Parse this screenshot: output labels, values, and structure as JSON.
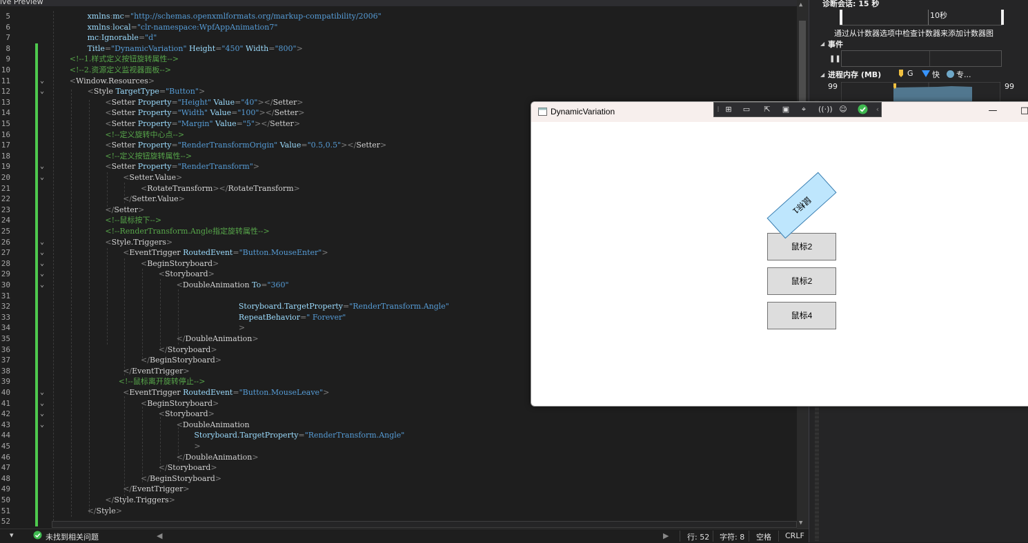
{
  "editor": {
    "tab_title": "ive Preview",
    "line_numbers": [
      "5",
      "6",
      "7",
      "8",
      "9",
      "10",
      "11",
      "12",
      "13",
      "14",
      "15",
      "16",
      "17",
      "18",
      "19",
      "20",
      "21",
      "22",
      "23",
      "24",
      "25",
      "26",
      "27",
      "28",
      "29",
      "30",
      "31",
      "32",
      "33",
      "34",
      "35",
      "36",
      "37",
      "38",
      "39",
      "40",
      "41",
      "42",
      "43",
      "44",
      "45",
      "46",
      "47",
      "48",
      "49",
      "50",
      "51",
      "52"
    ],
    "lines": [
      [
        [
          "at",
          "xmlns"
        ],
        [
          "pn",
          ":"
        ],
        [
          "at",
          "mc"
        ],
        [
          "pn",
          "="
        ],
        [
          "st",
          "\"http://schemas.openxmlformats.org/markup-compatibility/2006\""
        ]
      ],
      [
        [
          "at",
          "xmlns"
        ],
        [
          "pn",
          ":"
        ],
        [
          "at",
          "local"
        ],
        [
          "pn",
          "="
        ],
        [
          "st",
          "\"clr-namespace:WpfAppAnimation7\""
        ]
      ],
      [
        [
          "at",
          "mc"
        ],
        [
          "pn",
          ":"
        ],
        [
          "at",
          "Ignorable"
        ],
        [
          "pn",
          "="
        ],
        [
          "st",
          "\"d\""
        ]
      ],
      [
        [
          "at",
          "Title"
        ],
        [
          "pn",
          "="
        ],
        [
          "st",
          "\"DynamicVariation\""
        ],
        [
          "at",
          " Height"
        ],
        [
          "pn",
          "="
        ],
        [
          "st",
          "\"450\""
        ],
        [
          "at",
          " Width"
        ],
        [
          "pn",
          "="
        ],
        [
          "st",
          "\"800\""
        ],
        [
          "pn",
          ">"
        ]
      ],
      [
        [
          "cm",
          "<!--1.样式定义按钮旋转属性-->"
        ]
      ],
      [
        [
          "cm",
          "<!--2.资源定义监视器面板-->"
        ]
      ],
      [
        [
          "pn",
          "<"
        ],
        [
          "el",
          "Window.Resources"
        ],
        [
          "pn",
          ">"
        ]
      ],
      [
        [
          "pn",
          "<"
        ],
        [
          "el",
          "Style"
        ],
        [
          "at",
          " TargetType"
        ],
        [
          "pn",
          "="
        ],
        [
          "st",
          "\"Button\""
        ],
        [
          "pn",
          ">"
        ]
      ],
      [
        [
          "pn",
          "<"
        ],
        [
          "el",
          "Setter"
        ],
        [
          "at",
          " Property"
        ],
        [
          "pn",
          "="
        ],
        [
          "st",
          "\"Height\""
        ],
        [
          "at",
          " Value"
        ],
        [
          "pn",
          "="
        ],
        [
          "st",
          "\"40\""
        ],
        [
          "pn",
          "></"
        ],
        [
          "el",
          "Setter"
        ],
        [
          "pn",
          ">"
        ]
      ],
      [
        [
          "pn",
          "<"
        ],
        [
          "el",
          "Setter"
        ],
        [
          "at",
          " Property"
        ],
        [
          "pn",
          "="
        ],
        [
          "st",
          "\"Width\""
        ],
        [
          "at",
          " Value"
        ],
        [
          "pn",
          "="
        ],
        [
          "st",
          "\"100\""
        ],
        [
          "pn",
          "></"
        ],
        [
          "el",
          "Setter"
        ],
        [
          "pn",
          ">"
        ]
      ],
      [
        [
          "pn",
          "<"
        ],
        [
          "el",
          "Setter"
        ],
        [
          "at",
          " Property"
        ],
        [
          "pn",
          "="
        ],
        [
          "st",
          "\"Margin\""
        ],
        [
          "at",
          " Value"
        ],
        [
          "pn",
          "="
        ],
        [
          "st",
          "\"5\""
        ],
        [
          "pn",
          "></"
        ],
        [
          "el",
          "Setter"
        ],
        [
          "pn",
          ">"
        ]
      ],
      [
        [
          "cm",
          "<!--定义旋转中心点-->"
        ]
      ],
      [
        [
          "pn",
          "<"
        ],
        [
          "el",
          "Setter"
        ],
        [
          "at",
          " Property"
        ],
        [
          "pn",
          "="
        ],
        [
          "st",
          "\"RenderTransformOrigin\""
        ],
        [
          "at",
          " Value"
        ],
        [
          "pn",
          "="
        ],
        [
          "st",
          "\"0.5,0.5\""
        ],
        [
          "pn",
          "></"
        ],
        [
          "el",
          "Setter"
        ],
        [
          "pn",
          ">"
        ]
      ],
      [
        [
          "cm",
          "<!--定义按钮旋转属性-->"
        ]
      ],
      [
        [
          "pn",
          "<"
        ],
        [
          "el",
          "Setter"
        ],
        [
          "at",
          " Property"
        ],
        [
          "pn",
          "="
        ],
        [
          "st",
          "\"RenderTransform\""
        ],
        [
          "pn",
          ">"
        ]
      ],
      [
        [
          "pn",
          "<"
        ],
        [
          "el",
          "Setter.Value"
        ],
        [
          "pn",
          ">"
        ]
      ],
      [
        [
          "pn",
          "<"
        ],
        [
          "el",
          "RotateTransform"
        ],
        [
          "pn",
          "></"
        ],
        [
          "el",
          "RotateTransform"
        ],
        [
          "pn",
          ">"
        ]
      ],
      [
        [
          "pn",
          "</"
        ],
        [
          "el",
          "Setter.Value"
        ],
        [
          "pn",
          ">"
        ]
      ],
      [
        [
          "pn",
          "</"
        ],
        [
          "el",
          "Setter"
        ],
        [
          "pn",
          ">"
        ]
      ],
      [
        [
          "cm",
          "<!--鼠标按下-->"
        ]
      ],
      [
        [
          "cm",
          "<!--RenderTransform.Angle指定旋转属性-->"
        ]
      ],
      [
        [
          "pn",
          "<"
        ],
        [
          "el",
          "Style.Triggers"
        ],
        [
          "pn",
          ">"
        ]
      ],
      [
        [
          "pn",
          "<"
        ],
        [
          "el",
          "EventTrigger"
        ],
        [
          "at",
          " RoutedEvent"
        ],
        [
          "pn",
          "="
        ],
        [
          "st",
          "\"Button.MouseEnter\""
        ],
        [
          "pn",
          ">"
        ]
      ],
      [
        [
          "pn",
          "<"
        ],
        [
          "el",
          "BeginStoryboard"
        ],
        [
          "pn",
          ">"
        ]
      ],
      [
        [
          "pn",
          "<"
        ],
        [
          "el",
          "Storyboard"
        ],
        [
          "pn",
          ">"
        ]
      ],
      [
        [
          "pn",
          "<"
        ],
        [
          "el",
          "DoubleAnimation"
        ],
        [
          "at",
          " To"
        ],
        [
          "pn",
          "="
        ],
        [
          "st",
          "\"360\""
        ]
      ],
      [],
      [
        [
          "at",
          "Storyboard.TargetProperty"
        ],
        [
          "pn",
          "="
        ],
        [
          "st",
          "\"RenderTransform.Angle\""
        ]
      ],
      [
        [
          "at",
          "RepeatBehavior"
        ],
        [
          "pn",
          "="
        ],
        [
          "st",
          "\" Forever\""
        ]
      ],
      [
        [
          "pn",
          ">"
        ]
      ],
      [
        [
          "pn",
          "</"
        ],
        [
          "el",
          "DoubleAnimation"
        ],
        [
          "pn",
          ">"
        ]
      ],
      [
        [
          "pn",
          "</"
        ],
        [
          "el",
          "Storyboard"
        ],
        [
          "pn",
          ">"
        ]
      ],
      [
        [
          "pn",
          "</"
        ],
        [
          "el",
          "BeginStoryboard"
        ],
        [
          "pn",
          ">"
        ]
      ],
      [
        [
          "pn",
          "</"
        ],
        [
          "el",
          "EventTrigger"
        ],
        [
          "pn",
          ">"
        ]
      ],
      [
        [
          "cm",
          "<!--鼠标离开旋转停止-->"
        ]
      ],
      [
        [
          "pn",
          "<"
        ],
        [
          "el",
          "EventTrigger"
        ],
        [
          "at",
          " RoutedEvent"
        ],
        [
          "pn",
          "="
        ],
        [
          "st",
          "\"Button.MouseLeave\""
        ],
        [
          "pn",
          ">"
        ]
      ],
      [
        [
          "pn",
          "<"
        ],
        [
          "el",
          "BeginStoryboard"
        ],
        [
          "pn",
          ">"
        ]
      ],
      [
        [
          "pn",
          "<"
        ],
        [
          "el",
          "Storyboard"
        ],
        [
          "pn",
          ">"
        ]
      ],
      [
        [
          "pn",
          "<"
        ],
        [
          "el",
          "DoubleAnimation"
        ]
      ],
      [
        [
          "at",
          "Storyboard.TargetProperty"
        ],
        [
          "pn",
          "="
        ],
        [
          "st",
          "\"RenderTransform.Angle\""
        ]
      ],
      [
        [
          "pn",
          ">"
        ]
      ],
      [
        [
          "pn",
          "</"
        ],
        [
          "el",
          "DoubleAnimation"
        ],
        [
          "pn",
          ">"
        ]
      ],
      [
        [
          "pn",
          "</"
        ],
        [
          "el",
          "Storyboard"
        ],
        [
          "pn",
          ">"
        ]
      ],
      [
        [
          "pn",
          "</"
        ],
        [
          "el",
          "BeginStoryboard"
        ],
        [
          "pn",
          ">"
        ]
      ],
      [
        [
          "pn",
          "</"
        ],
        [
          "el",
          "EventTrigger"
        ],
        [
          "pn",
          ">"
        ]
      ],
      [
        [
          "pn",
          "</"
        ],
        [
          "el",
          "Style.Triggers"
        ],
        [
          "pn",
          ">"
        ]
      ],
      [
        [
          "pn",
          "</"
        ],
        [
          "el",
          "Style"
        ],
        [
          "pn",
          ">"
        ]
      ],
      []
    ]
  },
  "status": {
    "issues": "未找到相关问题",
    "line": "行: 52",
    "char": "字符: 8",
    "spaces": "空格",
    "eol": "CRLF"
  },
  "diagnostics": {
    "session": "诊断会话: 15 秒",
    "ten_sec": "10秒",
    "hint": "通过从计数器选项中检查计数器来添加计数器图",
    "events_title": "事件",
    "memory_title": "进程内存 (MB)",
    "legend_g": "G",
    "legend_fast": "快",
    "legend_private": "专...",
    "mem_left": "99",
    "mem_right": "99"
  },
  "window": {
    "title": "DynamicVariation",
    "minimize": "—",
    "maximize": "□",
    "buttons": [
      "鼠标1",
      "鼠标2",
      "鼠标2",
      "鼠标4"
    ]
  }
}
